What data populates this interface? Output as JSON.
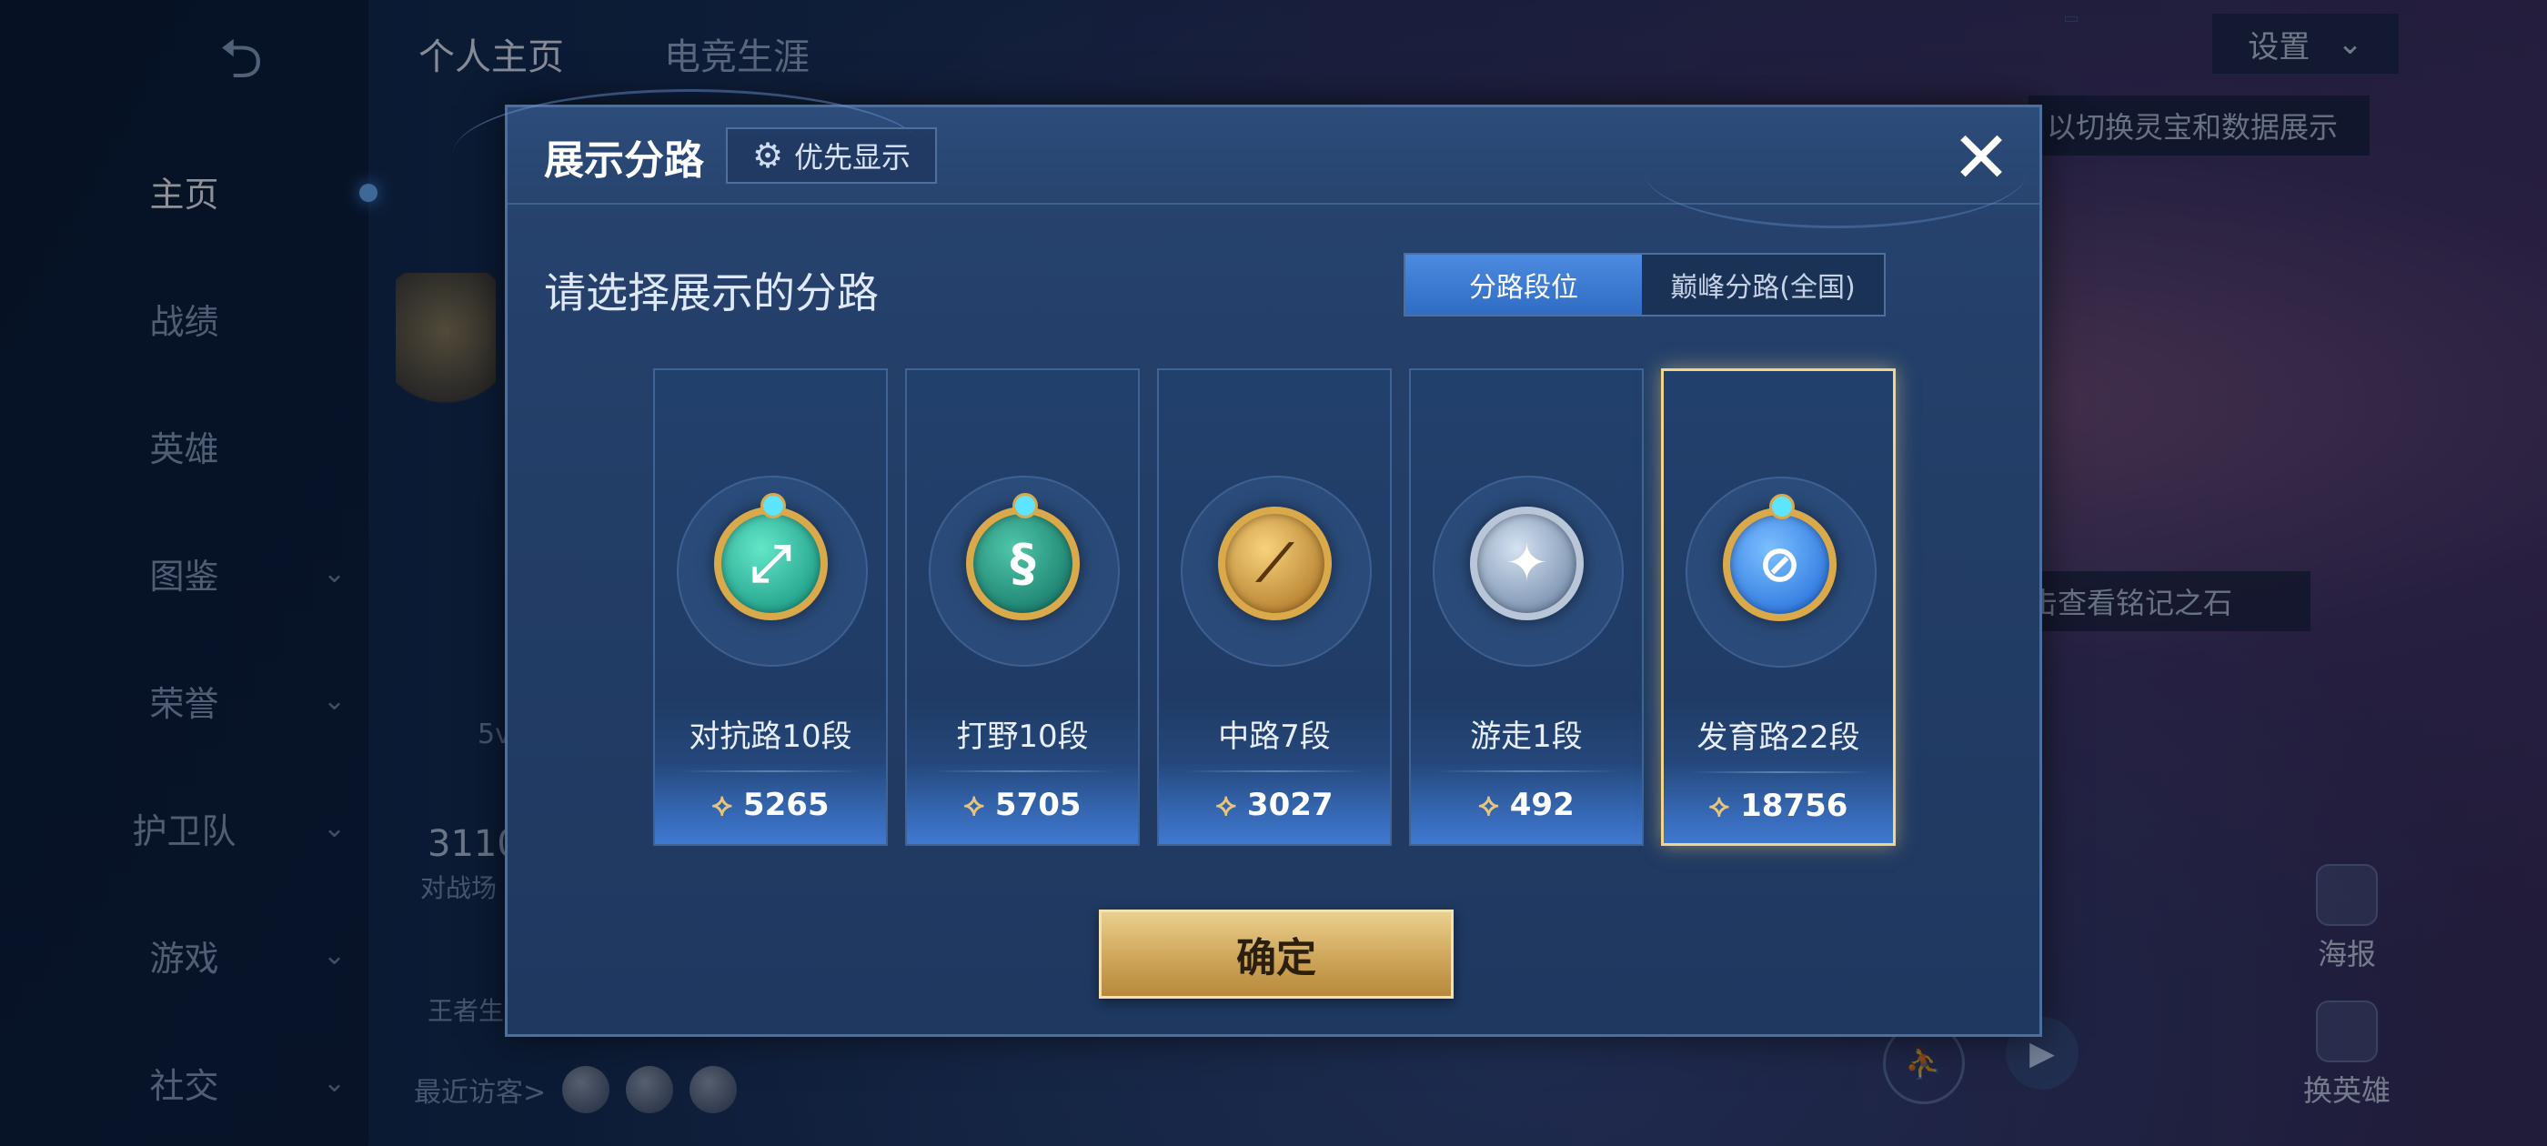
{
  "background": {
    "sidebar": {
      "back_label": "⮌",
      "items": [
        {
          "label": "主页",
          "chev": ""
        },
        {
          "label": "战绩",
          "chev": ""
        },
        {
          "label": "英雄",
          "chev": ""
        },
        {
          "label": "图鉴",
          "chev": "⌄"
        },
        {
          "label": "荣誉",
          "chev": "⌄"
        },
        {
          "label": "护卫队",
          "chev": "⌄"
        },
        {
          "label": "游戏",
          "chev": "⌄"
        },
        {
          "label": "社交",
          "chev": "⌄"
        }
      ]
    },
    "top_tabs": [
      "个人主页",
      "电竞生涯"
    ],
    "settings_label": "设置",
    "settings_chev": "⌄",
    "hint_top": "以切换灵宝和数据展示",
    "hint_mid": "击查看铭记之石",
    "stat_value": "3110",
    "stat_label": "对战场",
    "king_label": "王者生",
    "five_v": "5v",
    "visitors_label": "最近访客>",
    "right_actions": {
      "poster": "海报",
      "swap_hero": "换英雄"
    }
  },
  "modal": {
    "title": "展示分路",
    "priority_label": "优先显示",
    "close_label": "✕",
    "subtitle": "请选择展示的分路",
    "toggle": {
      "active": "分路段位",
      "inactive": "巅峰分路(全国)"
    },
    "cards": [
      {
        "label": "对抗路10段",
        "score": "5265",
        "emblem_color": "#13a98d",
        "glyph": "⤢",
        "selected": false
      },
      {
        "label": "打野10段",
        "score": "5705",
        "emblem_color": "#0d6b5d",
        "glyph": "§",
        "selected": false
      },
      {
        "label": "中路7段",
        "score": "3027",
        "emblem_color": "#c98d2c",
        "glyph": "⟋",
        "selected": false
      },
      {
        "label": "游走1段",
        "score": "492",
        "emblem_color": "#7d95b3",
        "glyph": "✦",
        "selected": false
      },
      {
        "label": "发育路22段",
        "score": "18756",
        "emblem_color": "#1a64d6",
        "glyph": "⊘",
        "selected": true
      }
    ],
    "confirm_label": "确定"
  }
}
